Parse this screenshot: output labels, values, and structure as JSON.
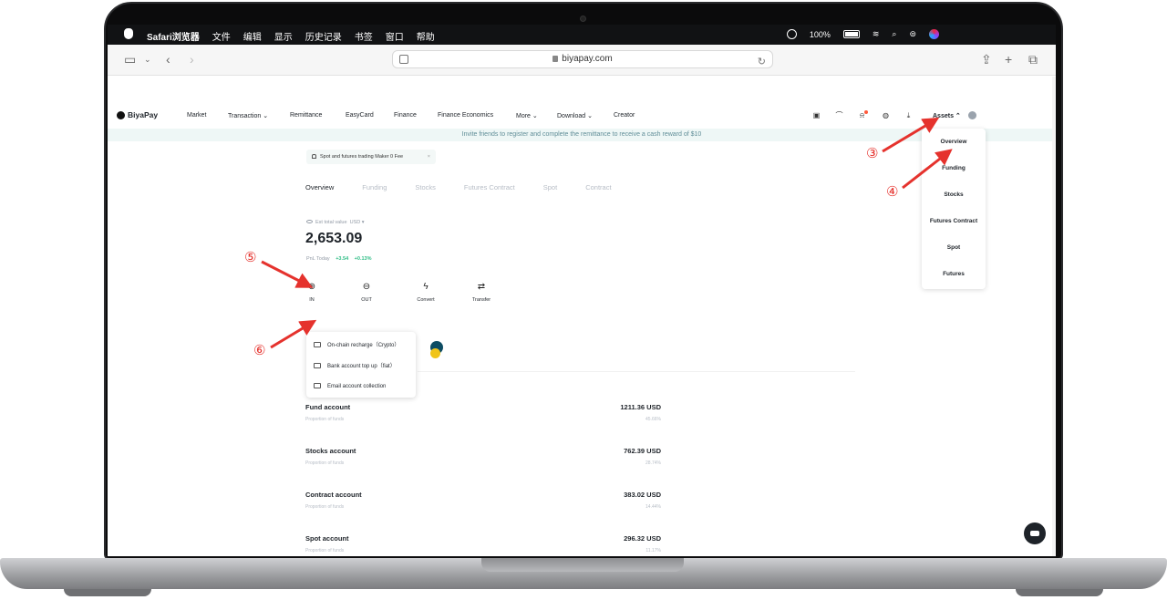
{
  "mac_menubar": {
    "app_name": "Safari浏览器",
    "menus": [
      "文件",
      "编辑",
      "显示",
      "历史记录",
      "书签",
      "窗口",
      "帮助"
    ],
    "battery": "100%"
  },
  "safari": {
    "url": "biyapay.com"
  },
  "site": {
    "logo": "BiyaPay",
    "nav": [
      "Market",
      "Transaction",
      "Remittance",
      "EasyCard",
      "Finance",
      "Finance Economics",
      "More",
      "Download",
      "Creator"
    ],
    "assets_label": "Assets",
    "banner": "Invite friends to register and complete the remittance to receive a cash reward of $10",
    "promo": "Spot and futures trading Maker 0 Fee",
    "tabs": [
      "Overview",
      "Funding",
      "Stocks",
      "Futures Contract",
      "Spot",
      "Contract"
    ],
    "est_label": "Est total value",
    "currency": "USD",
    "total_value": "2,653.09",
    "pnl_label": "PnL Today",
    "pnl_abs": "+3.54",
    "pnl_pct": "+0.13%",
    "actions": [
      "IN",
      "OUT",
      "Convert",
      "Transfer"
    ],
    "in_dropdown": [
      "On-chain recharge（Crypto）",
      "Bank account top up（fiat）",
      "Email account collection"
    ],
    "accounts": [
      {
        "name": "Fund account",
        "sub": "Proportion of funds",
        "value": "1211.36 USD",
        "pct": "45.66%"
      },
      {
        "name": "Stocks account",
        "sub": "Proportion of funds",
        "value": "762.39 USD",
        "pct": "28.74%"
      },
      {
        "name": "Contract account",
        "sub": "Proportion of funds",
        "value": "383.02 USD",
        "pct": "14.44%"
      },
      {
        "name": "Spot account",
        "sub": "Proportion of funds",
        "value": "296.32 USD",
        "pct": "11.17%"
      }
    ],
    "assets_dropdown": [
      "Overview",
      "Funding",
      "Stocks",
      "Futures Contract",
      "Spot",
      "Futures"
    ]
  },
  "annotations": {
    "step3": "③",
    "step4": "④",
    "step5": "⑤",
    "step6": "⑥",
    "color": "#e5322d"
  }
}
